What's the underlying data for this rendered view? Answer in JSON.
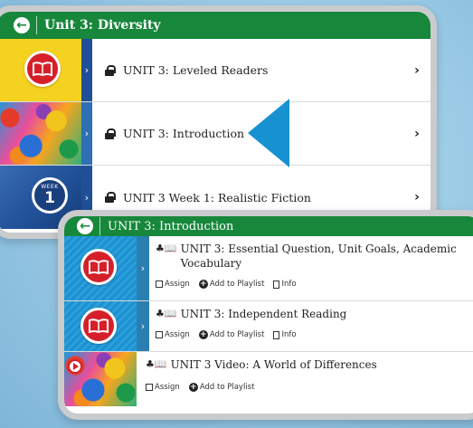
{
  "panel1": {
    "header": "Unit 3: Diversity",
    "rows": [
      {
        "title": "UNIT 3: Leveled Readers"
      },
      {
        "title": "UNIT 3: Introduction"
      },
      {
        "title": "UNIT 3 Week 1: Realistic Fiction",
        "badge_top": "WEEK",
        "badge_num": "1"
      }
    ]
  },
  "panel2": {
    "header": "UNIT 3: Introduction",
    "items": [
      {
        "title": "UNIT 3: Essential Question, Unit Goals, Academic Vocabulary",
        "actions": [
          "Assign",
          "Add to Playlist",
          "Info"
        ]
      },
      {
        "title": "UNIT 3: Independent Reading",
        "actions": [
          "Assign",
          "Add to Playlist",
          "Info"
        ]
      },
      {
        "title": "UNIT 3 Video: A World of Differences",
        "actions": [
          "Assign",
          "Add to Playlist"
        ]
      }
    ]
  },
  "icons": {
    "back": "back-arrow-icon",
    "lock": "lock-icon",
    "chevron": "chevron-right-icon",
    "book": "book-icon",
    "assign": "assign-icon",
    "add": "add-circle-icon",
    "info": "info-icon",
    "play": "play-icon",
    "pointer": "blue-arrow-pointer"
  },
  "colors": {
    "header_green": "#17873b",
    "book_red": "#d5202a",
    "yellow": "#f4d21f",
    "pointer_blue": "#1891d1",
    "week_blue": "#1f4f96"
  }
}
